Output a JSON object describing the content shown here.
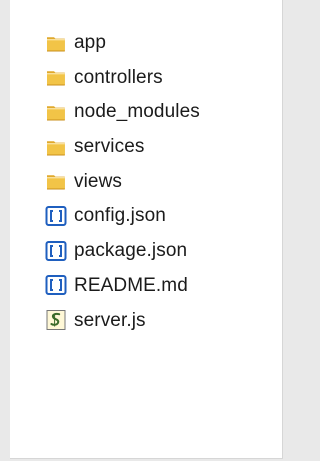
{
  "explorer": {
    "items": [
      {
        "label": "app",
        "icon": "folder-icon",
        "kind": "folder"
      },
      {
        "label": "controllers",
        "icon": "folder-icon",
        "kind": "folder"
      },
      {
        "label": "node_modules",
        "icon": "folder-icon",
        "kind": "folder"
      },
      {
        "label": "services",
        "icon": "folder-icon",
        "kind": "folder"
      },
      {
        "label": "views",
        "icon": "folder-icon",
        "kind": "folder"
      },
      {
        "label": "config.json",
        "icon": "json-file-icon",
        "kind": "json"
      },
      {
        "label": "package.json",
        "icon": "json-file-icon",
        "kind": "json"
      },
      {
        "label": "README.md",
        "icon": "json-file-icon",
        "kind": "json"
      },
      {
        "label": "server.js",
        "icon": "js-script-icon",
        "kind": "script"
      }
    ]
  },
  "colors": {
    "folder_front": "#f2c447",
    "folder_back": "#e0a92c",
    "folder_shadow": "#c98f1b",
    "json_bracket": "#1f5fbf",
    "script_ink": "#3b6b2a"
  }
}
